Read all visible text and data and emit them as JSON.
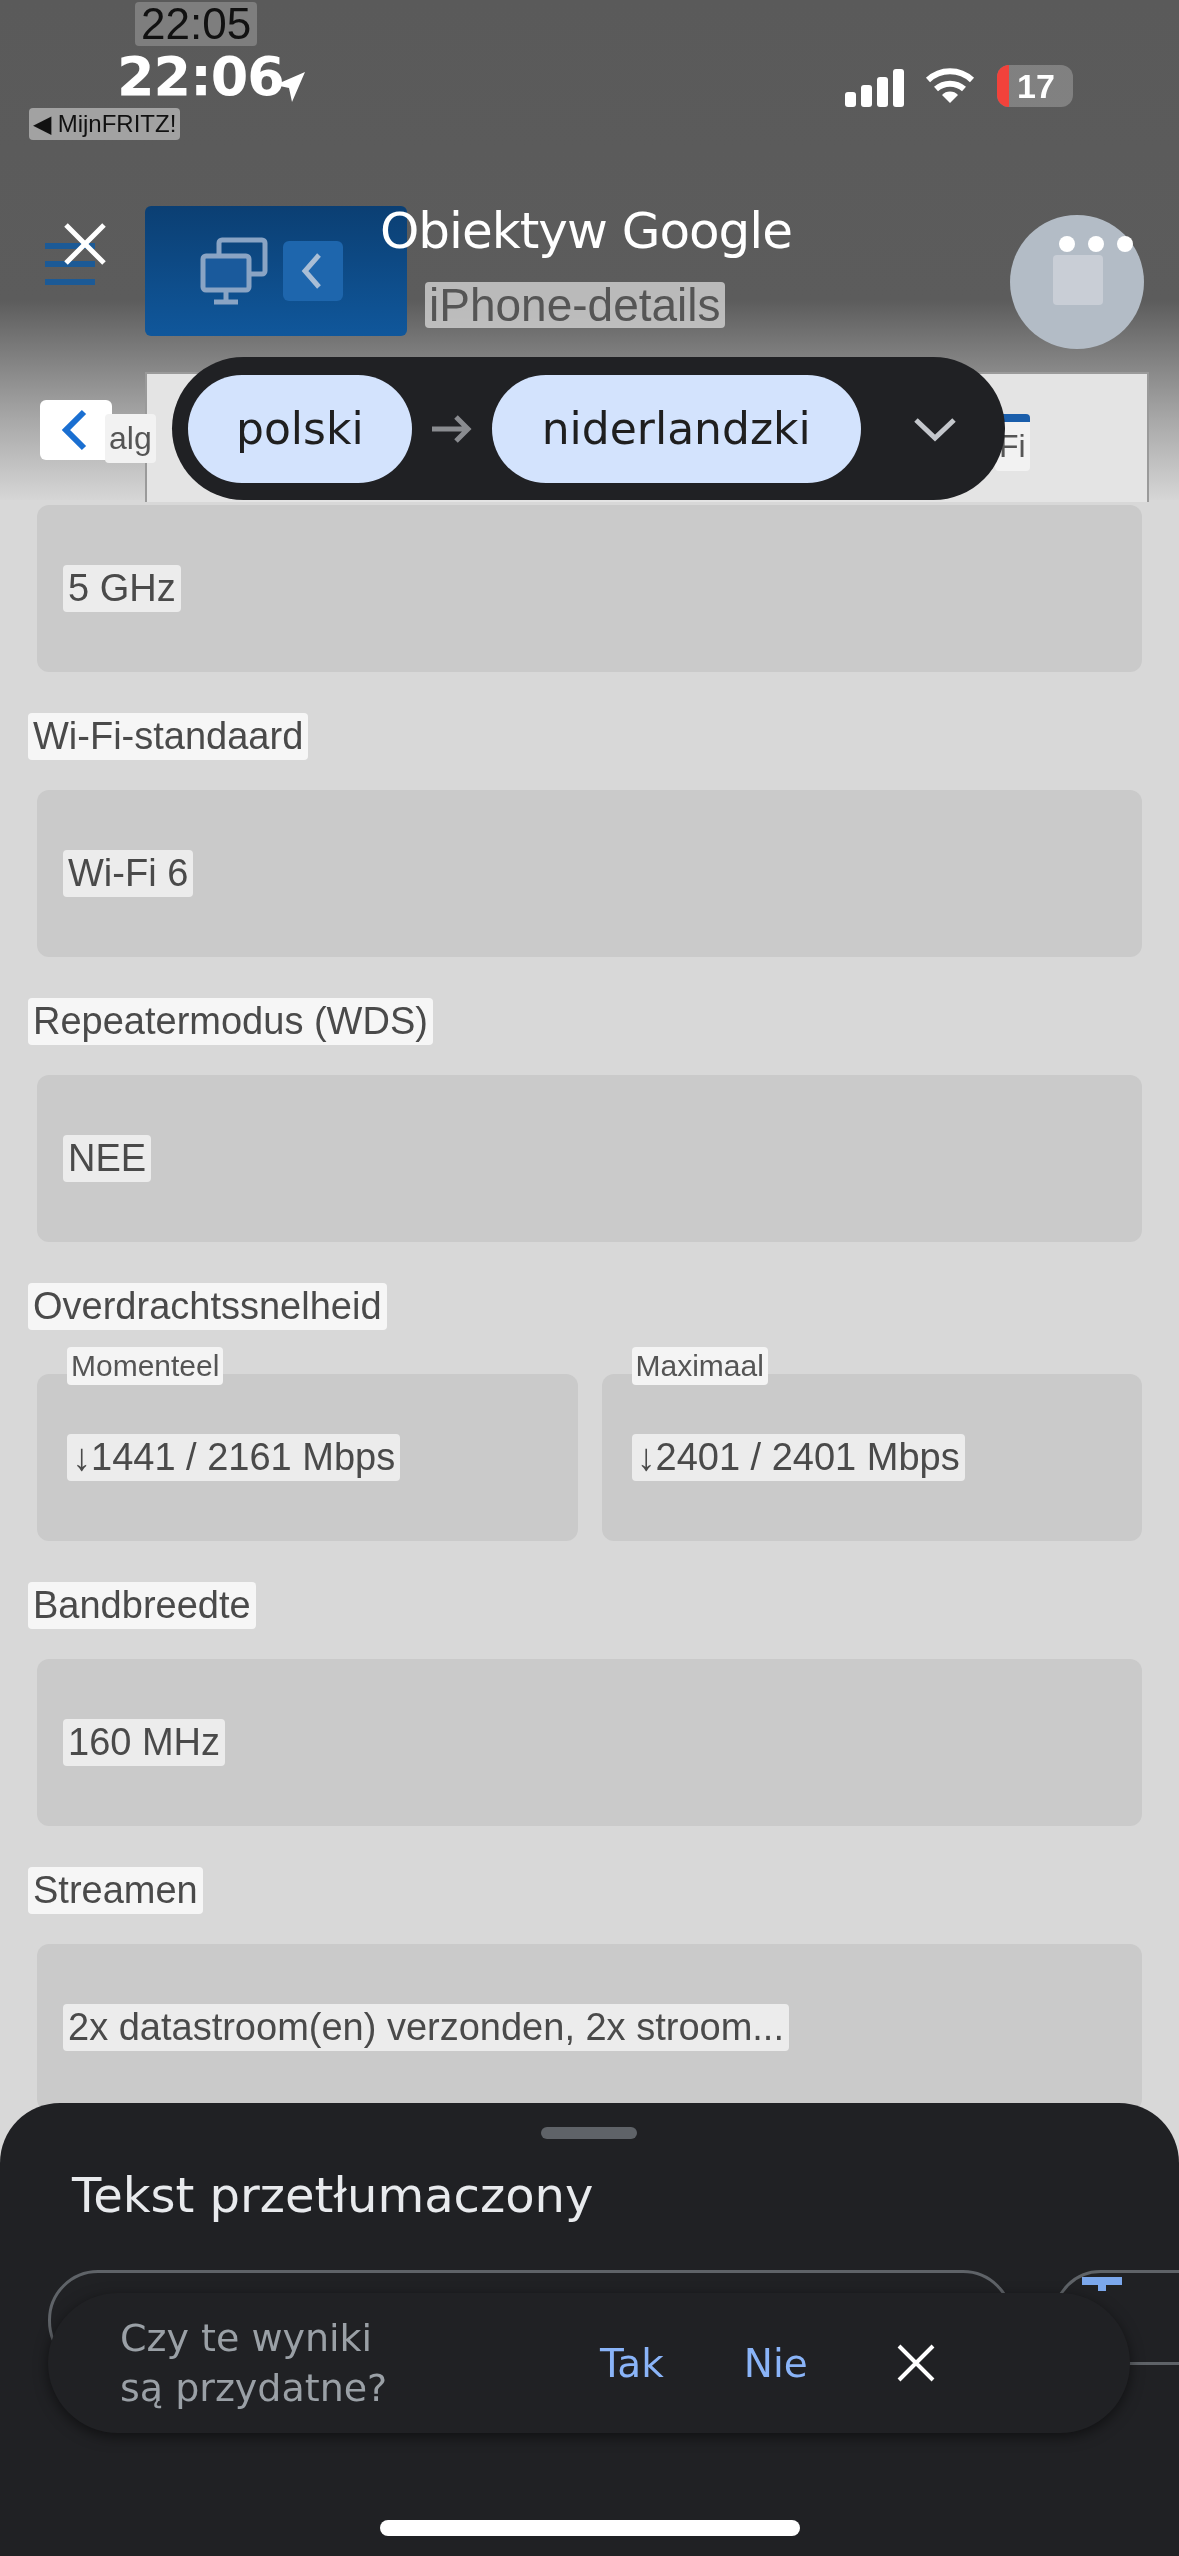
{
  "status_bar": {
    "time": "22:06",
    "underlying_time": "22:05",
    "back_app": "◀ MijnFRITZ!",
    "battery": "17"
  },
  "lens_header": {
    "title": "Obiektyw Google"
  },
  "page_header": {
    "title": "iPhone-details"
  },
  "languages": {
    "source": "polski",
    "target": "niderlandzki"
  },
  "tabs": [
    {
      "label": "alg",
      "selected": false
    },
    {
      "label": "Fi",
      "selected": true
    }
  ],
  "fields": [
    {
      "kind": "single",
      "value": "5 GHz"
    },
    {
      "kind": "single",
      "label": "Wi-Fi-standaard",
      "value": "Wi-Fi 6"
    },
    {
      "kind": "single",
      "label": "Repeatermodus (WDS)",
      "value": "NEE"
    },
    {
      "kind": "split",
      "label": "Overdrachtssnelheid",
      "parts": [
        {
          "label": "Momenteel",
          "value": "↓1441 / 2161 Mbps"
        },
        {
          "label": "Maximaal",
          "value": "↓2401 / 2401 Mbps"
        }
      ]
    },
    {
      "kind": "single",
      "label": "Bandbreedte",
      "value": "160 MHz"
    },
    {
      "kind": "single",
      "label": "Streamen",
      "value": "2x datastroom(en) verzonden, 2x stroom..."
    }
  ],
  "sheet": {
    "title": "Tekst przetłumaczony",
    "feedback": {
      "question": "Czy te wyniki są przydatne?",
      "yes": "Tak",
      "no": "Nie"
    }
  }
}
